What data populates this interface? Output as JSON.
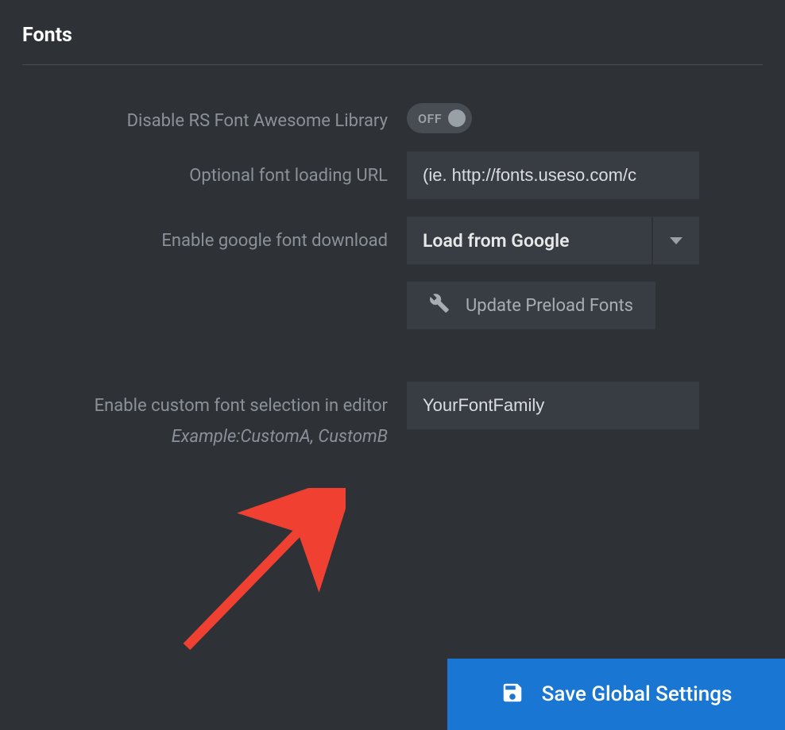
{
  "section": {
    "title": "Fonts"
  },
  "rows": {
    "disable_font_awesome": {
      "label": "Disable RS Font Awesome Library",
      "toggle_state": "OFF"
    },
    "font_loading_url": {
      "label": "Optional font loading URL",
      "placeholder": "(ie. http://fonts.useso.com/c",
      "value": ""
    },
    "google_font_download": {
      "label": "Enable google font download",
      "selected": "Load from Google"
    },
    "update_preload": {
      "button_label": "Update Preload Fonts"
    },
    "custom_font": {
      "label": "Enable custom font selection in editor",
      "example": "Example:CustomA, CustomB",
      "value": "YourFontFamily"
    }
  },
  "save_button": {
    "label": "Save Global Settings"
  },
  "colors": {
    "accent": "#1976d2",
    "arrow": "#ef4032"
  }
}
